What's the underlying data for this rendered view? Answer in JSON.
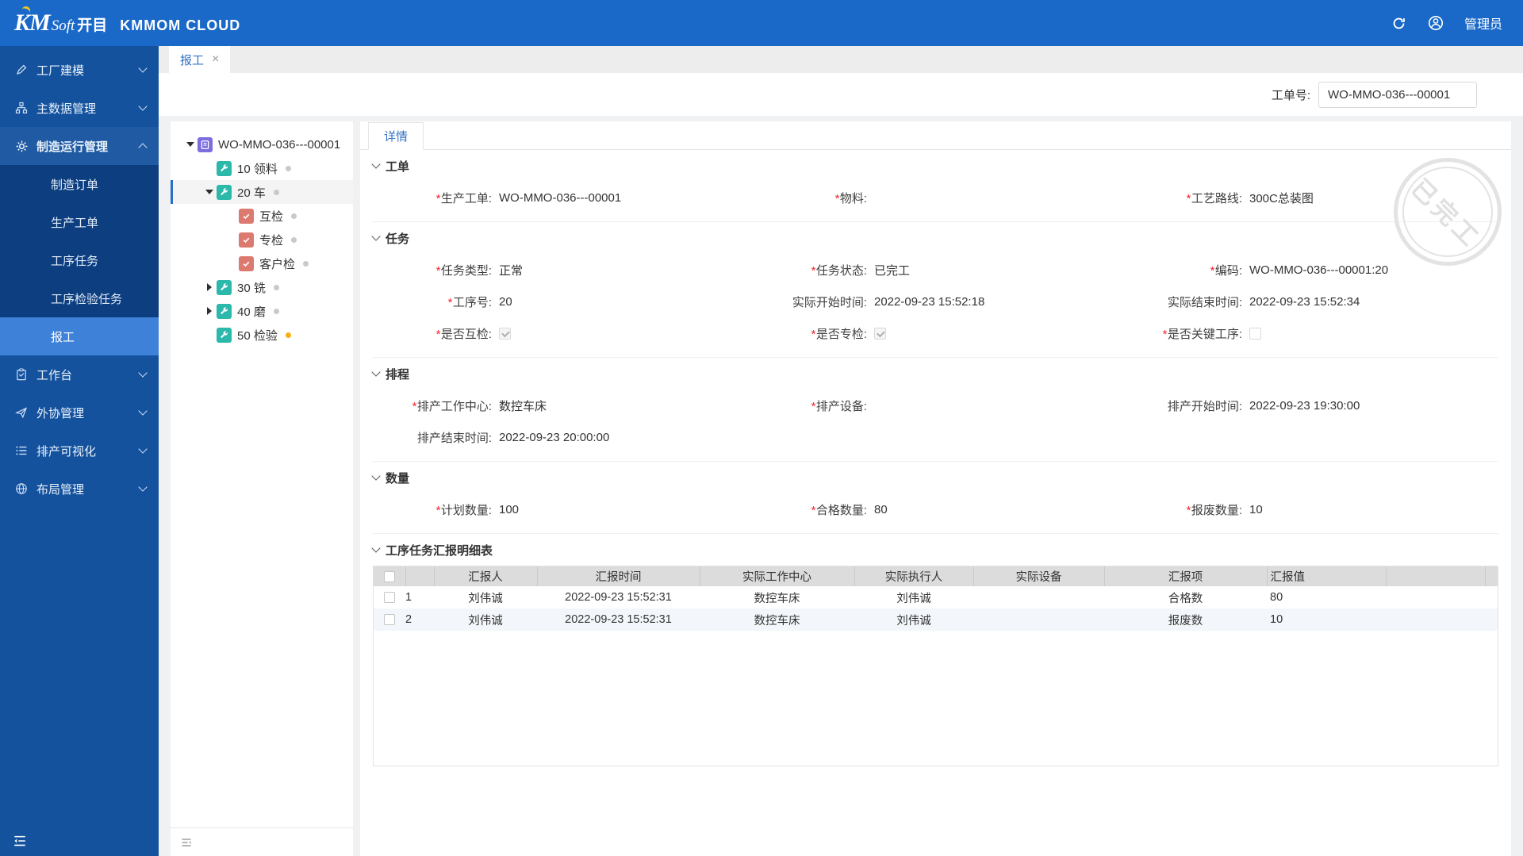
{
  "ui": {
    "required_mark": "*",
    "close_glyph": "×"
  },
  "colors": {
    "header_blue": "#1a69c8",
    "sidebar_blue": "#14529e",
    "submenu_blue": "#0d3f80",
    "selected_item_blue": "#3e81d8",
    "accent_blue": "#3573c4",
    "operation_icon_teal": "#2cb8aa",
    "order_icon_purple": "#7b6ce0",
    "check_icon_salmon": "#dd7a70",
    "status_dot_gray": "#c9c9c9",
    "status_dot_orange": "#faad14",
    "required_red": "#f5222d"
  },
  "header": {
    "brand_km": "KM",
    "brand_soft": "Soft",
    "brand_cn": "开目",
    "brand_product": "KMMOM CLOUD",
    "user_label": "管理员"
  },
  "sidebar": {
    "items": [
      {
        "label": "工厂建模"
      },
      {
        "label": "主数据管理"
      },
      {
        "label": "制造运行管理",
        "expanded": true
      },
      {
        "label": "工作台"
      },
      {
        "label": "外协管理"
      },
      {
        "label": "排产可视化"
      },
      {
        "label": "布局管理"
      }
    ],
    "mfg_children": [
      {
        "label": "制造订单"
      },
      {
        "label": "生产工单"
      },
      {
        "label": "工序任务"
      },
      {
        "label": "工序检验任务"
      },
      {
        "label": "报工",
        "selected": true
      }
    ]
  },
  "tab": {
    "label": "报工"
  },
  "toolbar": {
    "label": "工单号:",
    "value": "WO-MMO-036---00001"
  },
  "tree": {
    "nodes": [
      {
        "label": "WO-MMO-036---00001",
        "icon": "order",
        "expanded": true
      },
      {
        "label": "10 领料",
        "icon": "operation",
        "status_dot": "gray"
      },
      {
        "label": "20 车",
        "icon": "operation",
        "status_dot": "gray",
        "expanded": true,
        "selected": true
      },
      {
        "label": "互检",
        "icon": "check",
        "status_dot": "gray"
      },
      {
        "label": "专检",
        "icon": "check",
        "status_dot": "gray"
      },
      {
        "label": "客户检",
        "icon": "check",
        "status_dot": "gray"
      },
      {
        "label": "30 铣",
        "icon": "operation",
        "status_dot": "gray",
        "collapsed": true
      },
      {
        "label": "40 磨",
        "icon": "operation",
        "status_dot": "gray",
        "collapsed": true
      },
      {
        "label": "50 检验",
        "icon": "operation",
        "status_dot": "orange"
      }
    ]
  },
  "detail": {
    "tab_label": "详情",
    "order_section": {
      "title": "工单",
      "production_order": {
        "label": "生产工单:",
        "value": "WO-MMO-036---00001",
        "required": true
      },
      "material": {
        "label": "物料:",
        "value": "",
        "required": true
      },
      "process_route": {
        "label": "工艺路线:",
        "value": "300C总装图",
        "required": true
      }
    },
    "task_section": {
      "title": "任务",
      "task_type": {
        "label": "任务类型:",
        "value": "正常",
        "required": true
      },
      "task_status": {
        "label": "任务状态:",
        "value": "已完工",
        "required": true
      },
      "code": {
        "label": "编码:",
        "value": "WO-MMO-036---00001:20",
        "required": true
      },
      "op_no": {
        "label": "工序号:",
        "value": "20",
        "required": true
      },
      "actual_start": {
        "label": "实际开始时间:",
        "value": "2022-09-23 15:52:18"
      },
      "actual_end": {
        "label": "实际结束时间:",
        "value": "2022-09-23 15:52:34"
      },
      "mutual_check": {
        "label": "是否互检:",
        "checked": "true",
        "required": true
      },
      "special_check": {
        "label": "是否专检:",
        "checked": "true",
        "required": true
      },
      "key_operation": {
        "label": "是否关键工序:",
        "checked": "false",
        "required": true
      }
    },
    "schedule_section": {
      "title": "排程",
      "work_center": {
        "label": "排产工作中心:",
        "value": "数控车床",
        "required": true
      },
      "equipment": {
        "label": "排产设备:",
        "value": "",
        "required": true
      },
      "plan_start": {
        "label": "排产开始时间:",
        "value": "2022-09-23 19:30:00"
      },
      "plan_end": {
        "label": "排产结束时间:",
        "value": "2022-09-23 20:00:00"
      }
    },
    "quantity_section": {
      "title": "数量",
      "plan_qty": {
        "label": "计划数量:",
        "value": "100",
        "required": true
      },
      "qualified_qty": {
        "label": "合格数量:",
        "value": "80",
        "required": true
      },
      "scrap_qty": {
        "label": "报废数量:",
        "value": "10",
        "required": true
      }
    },
    "report_section": {
      "title": "工序任务汇报明细表"
    }
  },
  "report_table": {
    "headers": [
      "汇报人",
      "汇报时间",
      "实际工作中心",
      "实际执行人",
      "实际设备",
      "汇报项",
      "汇报值"
    ],
    "rows": [
      {
        "index": "1",
        "reporter": "刘伟诚",
        "time": "2022-09-23 15:52:31",
        "work_center": "数控车床",
        "executor": "刘伟诚",
        "equipment": "",
        "item": "合格数",
        "value": "80"
      },
      {
        "index": "2",
        "reporter": "刘伟诚",
        "time": "2022-09-23 15:52:31",
        "work_center": "数控车床",
        "executor": "刘伟诚",
        "equipment": "",
        "item": "报废数",
        "value": "10"
      }
    ]
  },
  "stamp": {
    "text": "已完工"
  }
}
